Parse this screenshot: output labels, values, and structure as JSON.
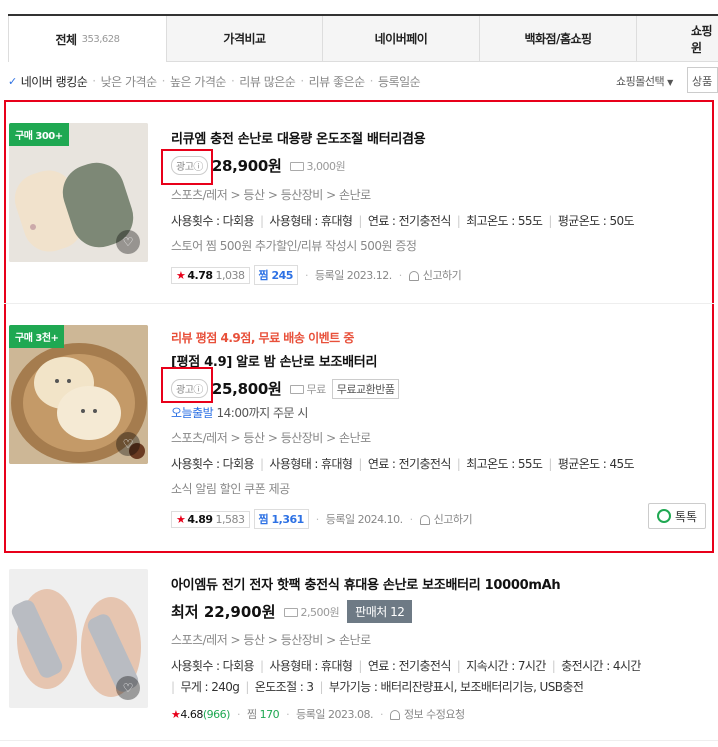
{
  "tabs": [
    {
      "label": "전체",
      "count": "353,628"
    },
    {
      "label": "가격비교",
      "count": ""
    },
    {
      "label": "네이버페이",
      "count": ""
    },
    {
      "label": "백화점/홈쇼핑",
      "count": ""
    },
    {
      "label": "쇼핑윈",
      "count": ""
    }
  ],
  "sort": {
    "active": "네이버 랭킹순",
    "options": [
      "낮은 가격순",
      "높은 가격순",
      "리뷰 많은순",
      "리뷰 좋은순",
      "등록일순"
    ],
    "shop_select": "쇼핑몰선택",
    "product_select": "상품"
  },
  "items": [
    {
      "badge": "구매 300+",
      "title": "리큐엠 충전 손난로 대용량 온도조절 배터리겸용",
      "ad_label": "광고",
      "price": "28,900원",
      "shipping": "3,000원",
      "category": "스포츠/레저 > 등산 > 등산장비 > 손난로",
      "specs": [
        "사용횟수 : 다회용",
        "사용형태 : 휴대형",
        "연료 : 전기충전식",
        "최고온도 : 55도",
        "평균온도 : 50도"
      ],
      "extra": "스토어 찜 500원 추가할인/리뷰 작성시 500원 증정",
      "rating": "4.78",
      "reviews": "1,038",
      "jjim_label": "찜",
      "jjim": "245",
      "registered": "등록일 2023.12.",
      "report": "신고하기"
    },
    {
      "badge": "구매 3천+",
      "promo": "리뷰 평점 4.9점, 무료 배송 이벤트 중",
      "title": "[평점 4.9] 알로 밤 손난로 보조배터리",
      "ad_label": "광고",
      "price": "25,800원",
      "shipping": "무료",
      "tag": "무료교환반품",
      "fast_label": "오늘출발",
      "fast_note": "14:00까지 주문 시",
      "category": "스포츠/레저 > 등산 > 등산장비 > 손난로",
      "specs": [
        "사용횟수 : 다회용",
        "사용형태 : 휴대형",
        "연료 : 전기충전식",
        "최고온도 : 55도",
        "평균온도 : 45도"
      ],
      "extra": "소식 알림 할인 쿠폰 제공",
      "rating": "4.89",
      "reviews": "1,583",
      "jjim_label": "찜",
      "jjim": "1,361",
      "registered": "등록일 2024.10.",
      "report": "신고하기",
      "talk": "톡톡"
    },
    {
      "title": "아이엠듀 전기 전자 핫팩 충전식 휴대용 손난로 보조배터리 10000mAh",
      "price_prefix": "최저",
      "price": "22,900원",
      "shipping": "2,500원",
      "sellers": "판매처 12",
      "category": "스포츠/레저 > 등산 > 등산장비 > 손난로",
      "specs": [
        "사용횟수 : 다회용",
        "사용형태 : 휴대형",
        "연료 : 전기충전식",
        "지속시간 : 7시간",
        "충전시간 : 4시간"
      ],
      "specs2": [
        "무게 : 240g",
        "온도조절 : 3",
        "부가기능 : 배터리잔량표시, 보조배터리기능, USB충전"
      ],
      "rating": "4.68",
      "reviews": "(966)",
      "jjim_label": "찜",
      "jjim": "170",
      "registered": "등록일 2023.08.",
      "report": "정보 수정요청"
    }
  ],
  "colors": {
    "accent_red": "#e8001a",
    "badge_green": "#1fa852",
    "link_blue": "#2d71e4",
    "promo_orange": "#e8503a"
  }
}
